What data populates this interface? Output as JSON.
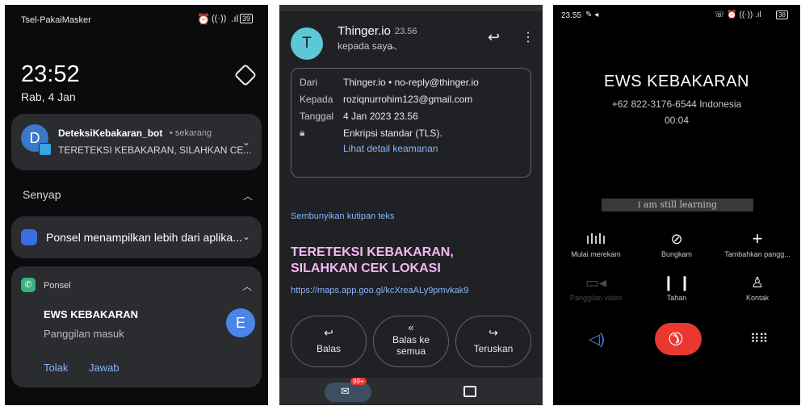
{
  "screen1": {
    "carrier": "Tsel-PakaiMasker",
    "battery": "39",
    "time": "23:52",
    "date": "Rab, 4 Jan",
    "notif1": {
      "avatar": "D",
      "app": "DeteksiKebakaran_bot",
      "when": "• sekarang",
      "text": "TERETEKSI KEBAKARAN, SILAHKAN CE..."
    },
    "section": "Senyap",
    "notif2": {
      "text": "Ponsel menampilkan lebih dari aplika..."
    },
    "notif3": {
      "app": "Ponsel",
      "caller": "EWS KEBAKARAN",
      "status": "Panggilan masuk",
      "avatar": "E",
      "decline": "Tolak",
      "answer": "Jawab"
    }
  },
  "screen2": {
    "avatar": "T",
    "sender": "Thinger.io",
    "time": "23.56",
    "to_me": "kepada saya",
    "details": {
      "from_label": "Dari",
      "from_value": "Thinger.io • no-reply@thinger.io",
      "to_label": "Kepada",
      "to_value": "roziqnurrohim123@gmail.com",
      "date_label": "Tanggal",
      "date_value": "4 Jan 2023 23.56",
      "security": "Enkripsi standar (TLS).",
      "security_link": "Lihat detail keamanan"
    },
    "hide_quote": "Sembunyikan kutipan teks",
    "headline_1": "TERETEKSI KEBAKARAN,",
    "headline_2": "SILAHKAN CEK LOKASI",
    "link": "https://maps.app.goo.gl/kcXreaALy9pmvkak9",
    "reply": "Balas",
    "reply_all_1": "Balas ke",
    "reply_all_2": "semua",
    "forward": "Teruskan",
    "badge": "99+"
  },
  "screen3": {
    "status_time": "23.55",
    "battery": "38",
    "caller": "EWS KEBAKARAN",
    "number": "+62 822-3176-6544",
    "country": "Indonesia",
    "duration": "00:04",
    "watermark": "i am still learning",
    "controls": [
      "Mulai merekam",
      "Bungkam",
      "Tambahkan pangg...",
      "Panggilan video",
      "Tahan",
      "Kontak"
    ]
  },
  "colors": {
    "accent_blue": "#8ab4f8",
    "headline_pink": "#f8b6f6",
    "hangup_red": "#e8382f",
    "teal_avatar": "#5ec7d6"
  }
}
